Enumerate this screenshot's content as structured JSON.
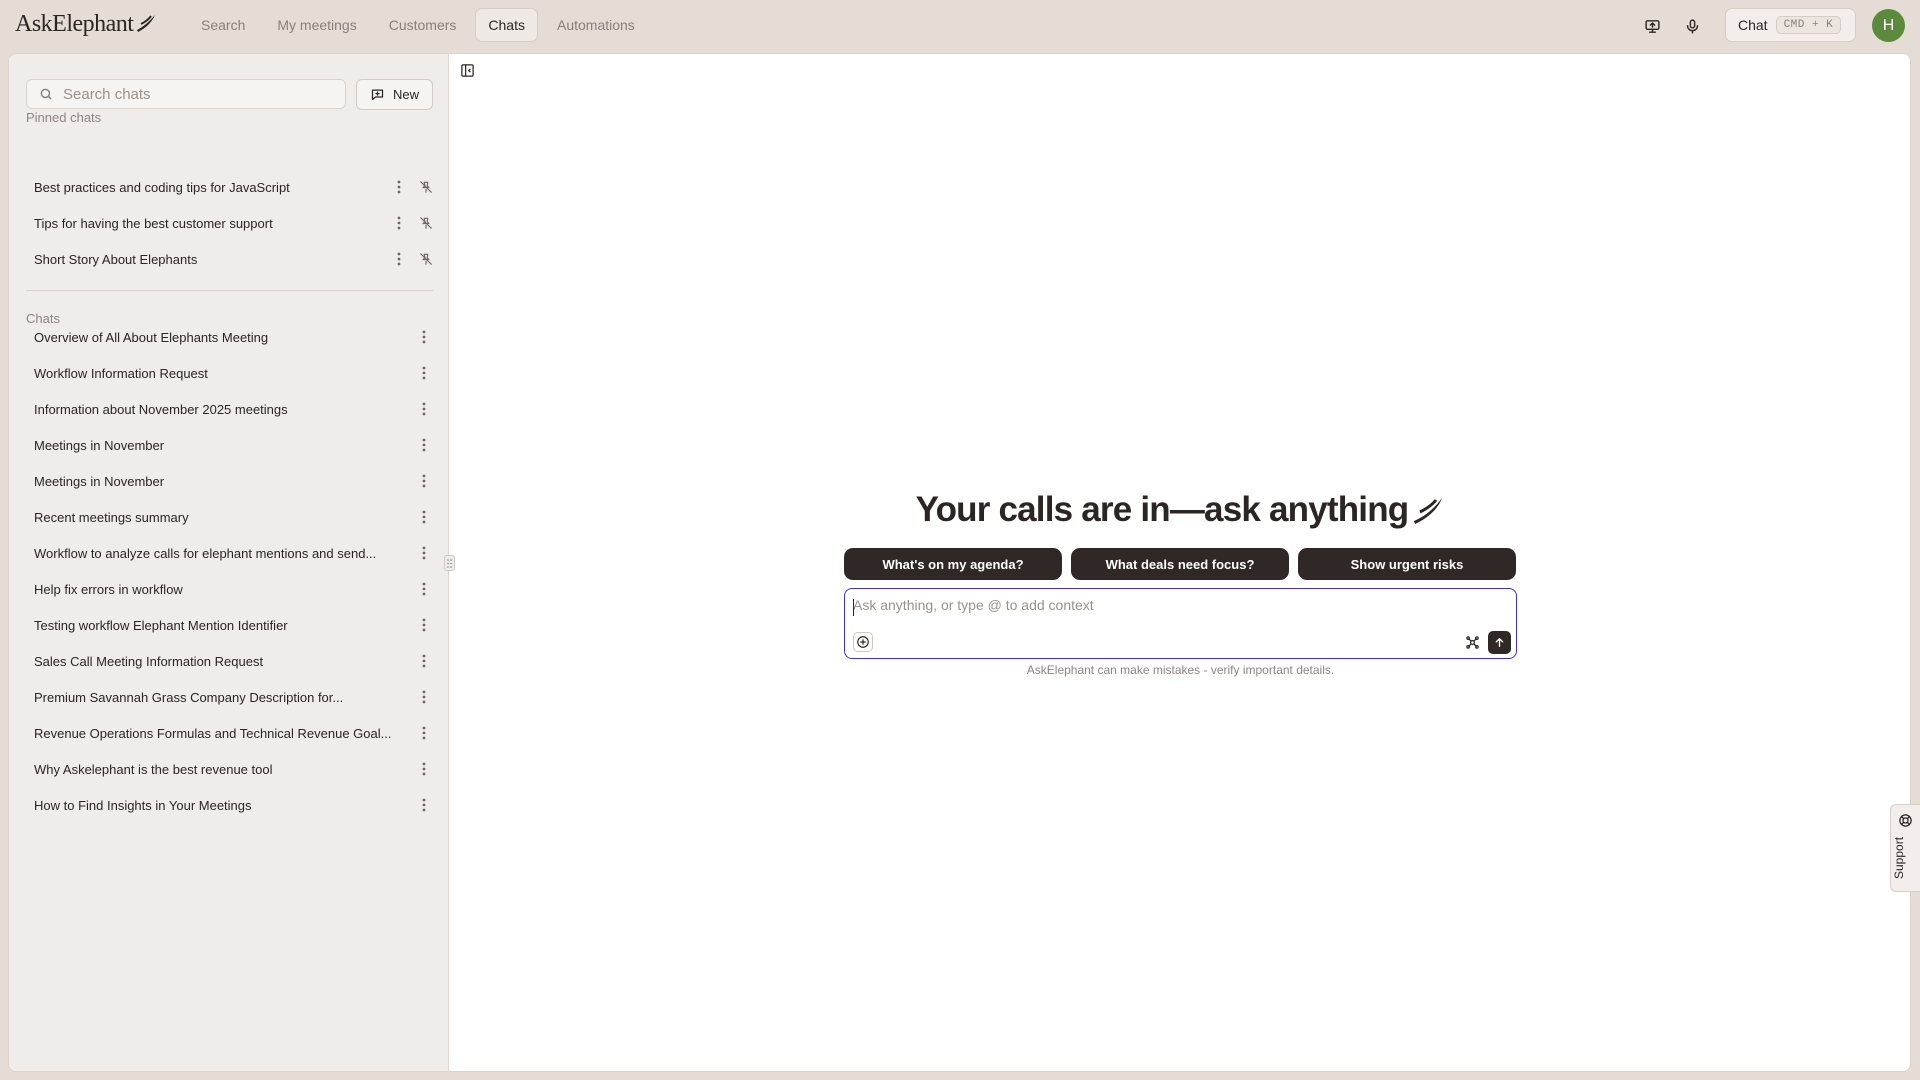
{
  "app": {
    "logo": "AskElephant"
  },
  "nav": {
    "items": [
      {
        "label": "Search",
        "active": false
      },
      {
        "label": "My meetings",
        "active": false
      },
      {
        "label": "Customers",
        "active": false
      },
      {
        "label": "Chats",
        "active": true
      },
      {
        "label": "Automations",
        "active": false
      }
    ]
  },
  "header": {
    "chat_label": "Chat",
    "chat_shortcut": "CMD + K",
    "avatar_initial": "H",
    "icons": [
      "screen-share-icon",
      "microphone-icon"
    ]
  },
  "sidebar": {
    "search_placeholder": "Search chats",
    "new_label": "New",
    "pinned_label": "Pinned chats",
    "pinned": [
      "Best practices and coding tips for JavaScript",
      "Tips for having the best customer support",
      "Short Story About Elephants"
    ],
    "chats_label": "Chats",
    "chats": [
      "Overview of All About Elephants Meeting",
      "Workflow Information Request",
      "Information about November 2025 meetings",
      "Meetings in November",
      "Meetings in November",
      "Recent meetings summary",
      "Workflow to analyze calls for elephant mentions and send...",
      "Help fix errors in workflow",
      "Testing workflow Elephant Mention Identifier",
      "Sales Call Meeting Information Request",
      "Premium Savannah Grass Company Description for...",
      "Revenue Operations Formulas and Technical Revenue Goal...",
      "Why Askelephant is the best revenue tool",
      "How to Find Insights in Your Meetings"
    ]
  },
  "main": {
    "hero": "Your calls are in—ask anything",
    "suggestions": [
      "What's on my agenda?",
      "What deals need focus?",
      "Show urgent risks"
    ],
    "composer_placeholder": "Ask anything, or type @ to add context",
    "disclaimer": "AskElephant can make mistakes - verify important details."
  },
  "support": {
    "label": "Support"
  },
  "colors": {
    "accent_dark": "#2f2826",
    "focus": "#3b35c9",
    "avatar": "#5b8a3d",
    "chrome": "#e6dcd6"
  }
}
